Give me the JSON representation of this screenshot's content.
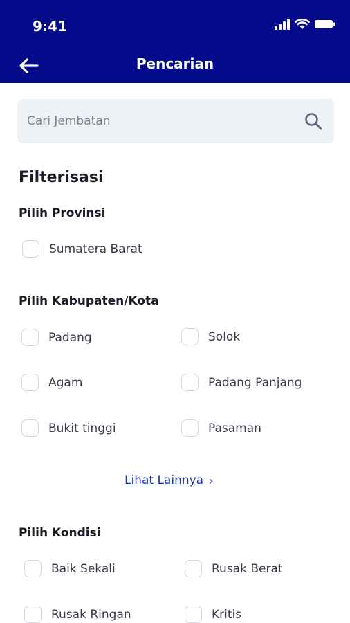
{
  "status_bar": {
    "time": "9:41"
  },
  "app_bar": {
    "title": "Pencarian"
  },
  "search": {
    "placeholder": "Cari Jembatan",
    "value": ""
  },
  "filter": {
    "heading": "Filterisasi",
    "provinsi": {
      "label": "Pilih Provinsi",
      "options": [
        "Sumatera Barat"
      ]
    },
    "kabupaten": {
      "label": "Pilih Kabupaten/Kota",
      "options": [
        "Padang",
        "Solok",
        "Agam",
        "Padang Panjang",
        "Bukit tinggi",
        "Pasaman"
      ],
      "more_link": "Lihat Lainnya"
    },
    "kondisi": {
      "label": "Pilih Kondisi",
      "options": [
        "Baik Sekali",
        "Rusak Berat",
        "Rusak Ringan",
        "Kritis"
      ]
    }
  },
  "colors": {
    "primary": "#050c8c",
    "link": "#1a36b8",
    "search_bg": "#eef1f5"
  }
}
